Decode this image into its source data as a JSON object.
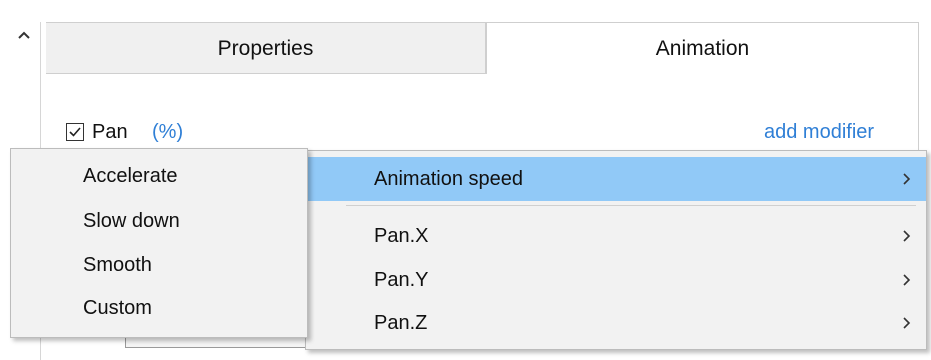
{
  "header": {
    "collapse_icon": "chevron-up-icon"
  },
  "tabs": [
    {
      "label": "Properties",
      "active": false
    },
    {
      "label": "Animation",
      "active": true
    }
  ],
  "property_row": {
    "checked": true,
    "name": "Pan",
    "unit": "(%)",
    "add_modifier_label": "add modifier"
  },
  "context_menu": {
    "items": [
      {
        "label": "Animation speed",
        "has_submenu": true,
        "highlighted": true
      },
      {
        "label": "Pan.X",
        "has_submenu": true,
        "highlighted": false
      },
      {
        "label": "Pan.Y",
        "has_submenu": true,
        "highlighted": false
      },
      {
        "label": "Pan.Z",
        "has_submenu": true,
        "highlighted": false
      }
    ],
    "highlight_color": "#91c9f7"
  },
  "submenu": {
    "items": [
      {
        "label": "Accelerate"
      },
      {
        "label": "Slow down"
      },
      {
        "label": "Smooth"
      },
      {
        "label": "Custom"
      }
    ]
  },
  "colors": {
    "link": "#2f7fd6",
    "menu_bg": "#f2f2f2",
    "inactive_tab_bg": "#f0f0f0"
  }
}
